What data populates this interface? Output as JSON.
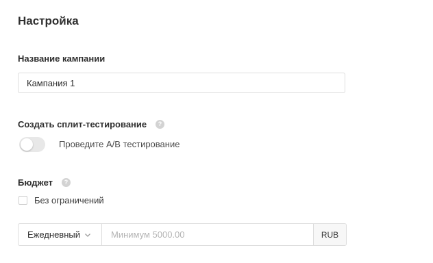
{
  "section": {
    "title": "Настройка"
  },
  "campaign_name": {
    "label": "Название кампании",
    "value": "Кампания 1"
  },
  "split_test": {
    "label": "Создать сплит-тестирование",
    "help_icon": "question-circle",
    "toggle_on": false,
    "toggle_text": "Проведите A/B тестирование"
  },
  "budget": {
    "label": "Бюджет",
    "help_icon": "question-circle",
    "unlimited_label": "Без ограничений",
    "unlimited_checked": false,
    "period_selected": "Ежедневный",
    "amount_value": "",
    "amount_placeholder": "Минимум 5000.00",
    "currency": "RUB"
  },
  "colors": {
    "border": "#dcdcdc",
    "help_icon_bg": "#d3d3d3",
    "toggle_off_bg": "#e8e8e8"
  }
}
